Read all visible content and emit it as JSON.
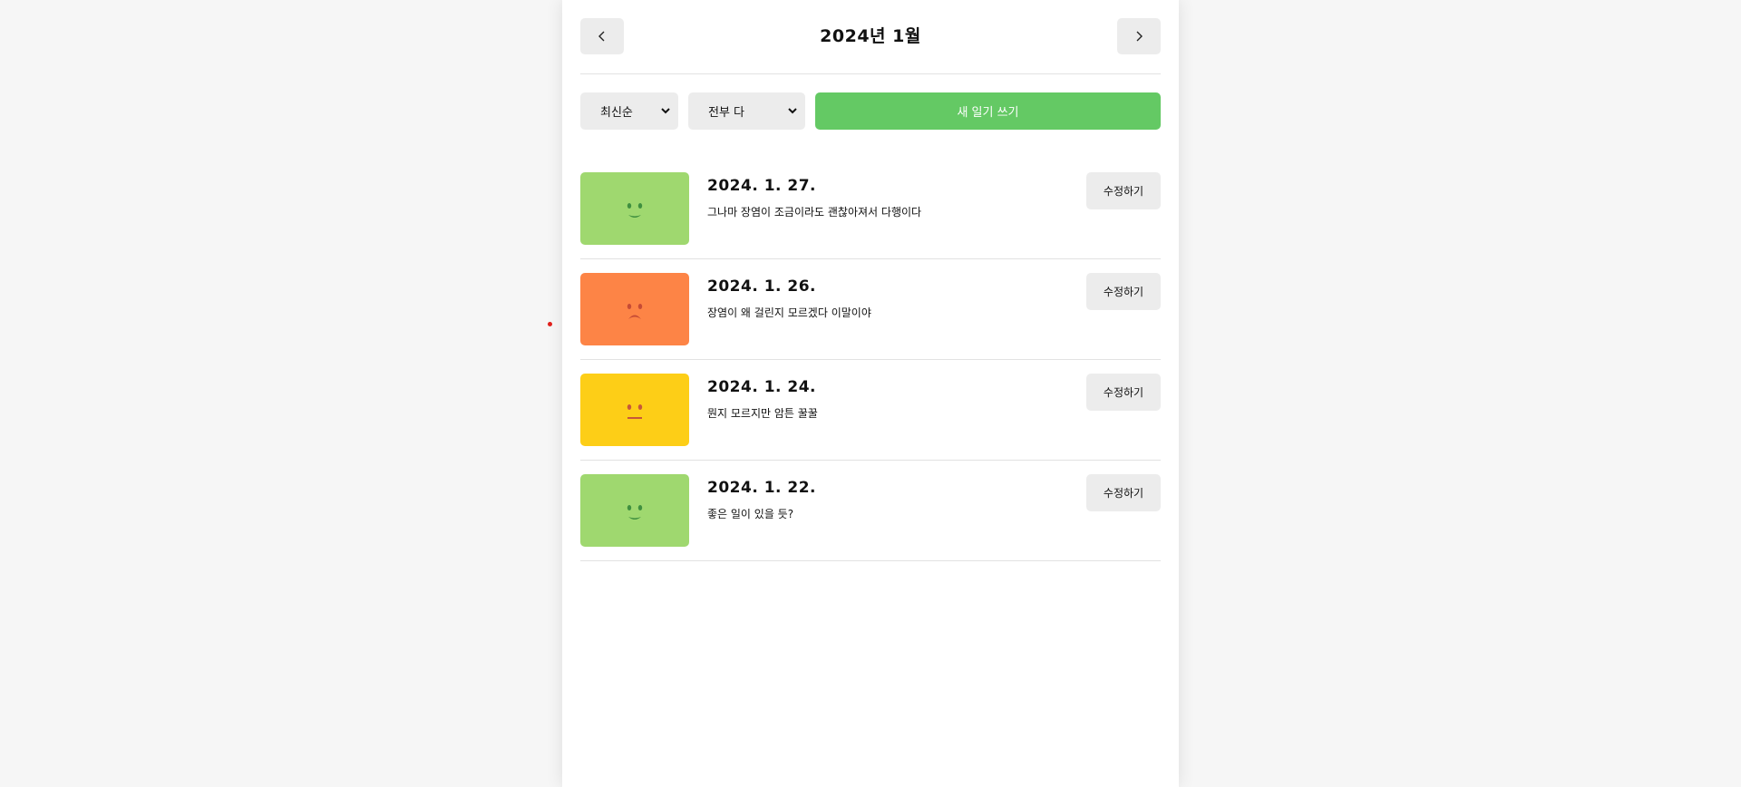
{
  "header": {
    "title": "2024년 1월",
    "prev_icon": "chevron-left-icon",
    "next_icon": "chevron-right-icon"
  },
  "menu": {
    "sort_selected": "최신순",
    "filter_selected": "전부 다",
    "new_button_label": "새 일기 쓰기"
  },
  "colors": {
    "background": "#f6f6f6",
    "primary_button": "#64c964",
    "button_gray": "#ececec",
    "emotion_good": "#9fd86f",
    "emotion_bad": "#fd8446",
    "emotion_neutral": "#fdce17"
  },
  "diaries": [
    {
      "date": "2024. 1. 27.",
      "content": "그나마 장염이 조금이라도 괜찮아져서 다행이다",
      "emotion": "good",
      "edit_label": "수정하기"
    },
    {
      "date": "2024. 1. 26.",
      "content": "장염이 왜 걸린지 모르겠다 이말이야",
      "emotion": "bad",
      "edit_label": "수정하기"
    },
    {
      "date": "2024. 1. 24.",
      "content": "뭔지 모르지만 암튼 꿀꿀",
      "emotion": "neutral",
      "edit_label": "수정하기"
    },
    {
      "date": "2024. 1. 22.",
      "content": "좋은 일이 있을 듯?",
      "emotion": "good",
      "edit_label": "수정하기"
    }
  ]
}
